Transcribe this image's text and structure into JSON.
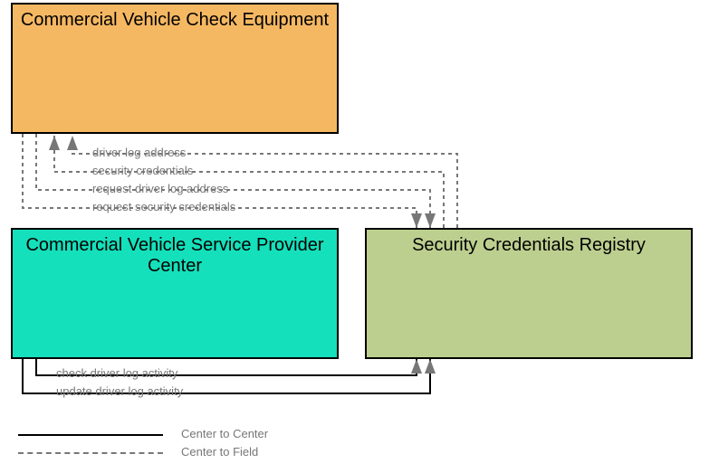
{
  "nodes": {
    "cvce": "Commercial Vehicle Check Equipment",
    "cvspc": "Commercial Vehicle Service Provider Center",
    "scr": "Security Credentials Registry"
  },
  "flows": {
    "f1": "driver log address",
    "f2": "security credentials",
    "f3": "request driver log address",
    "f4": "request security credentials",
    "f5": "check driver log activity",
    "f6": "update driver log activity"
  },
  "legend": {
    "c2c": "Center to Center",
    "c2f": "Center to Field"
  }
}
